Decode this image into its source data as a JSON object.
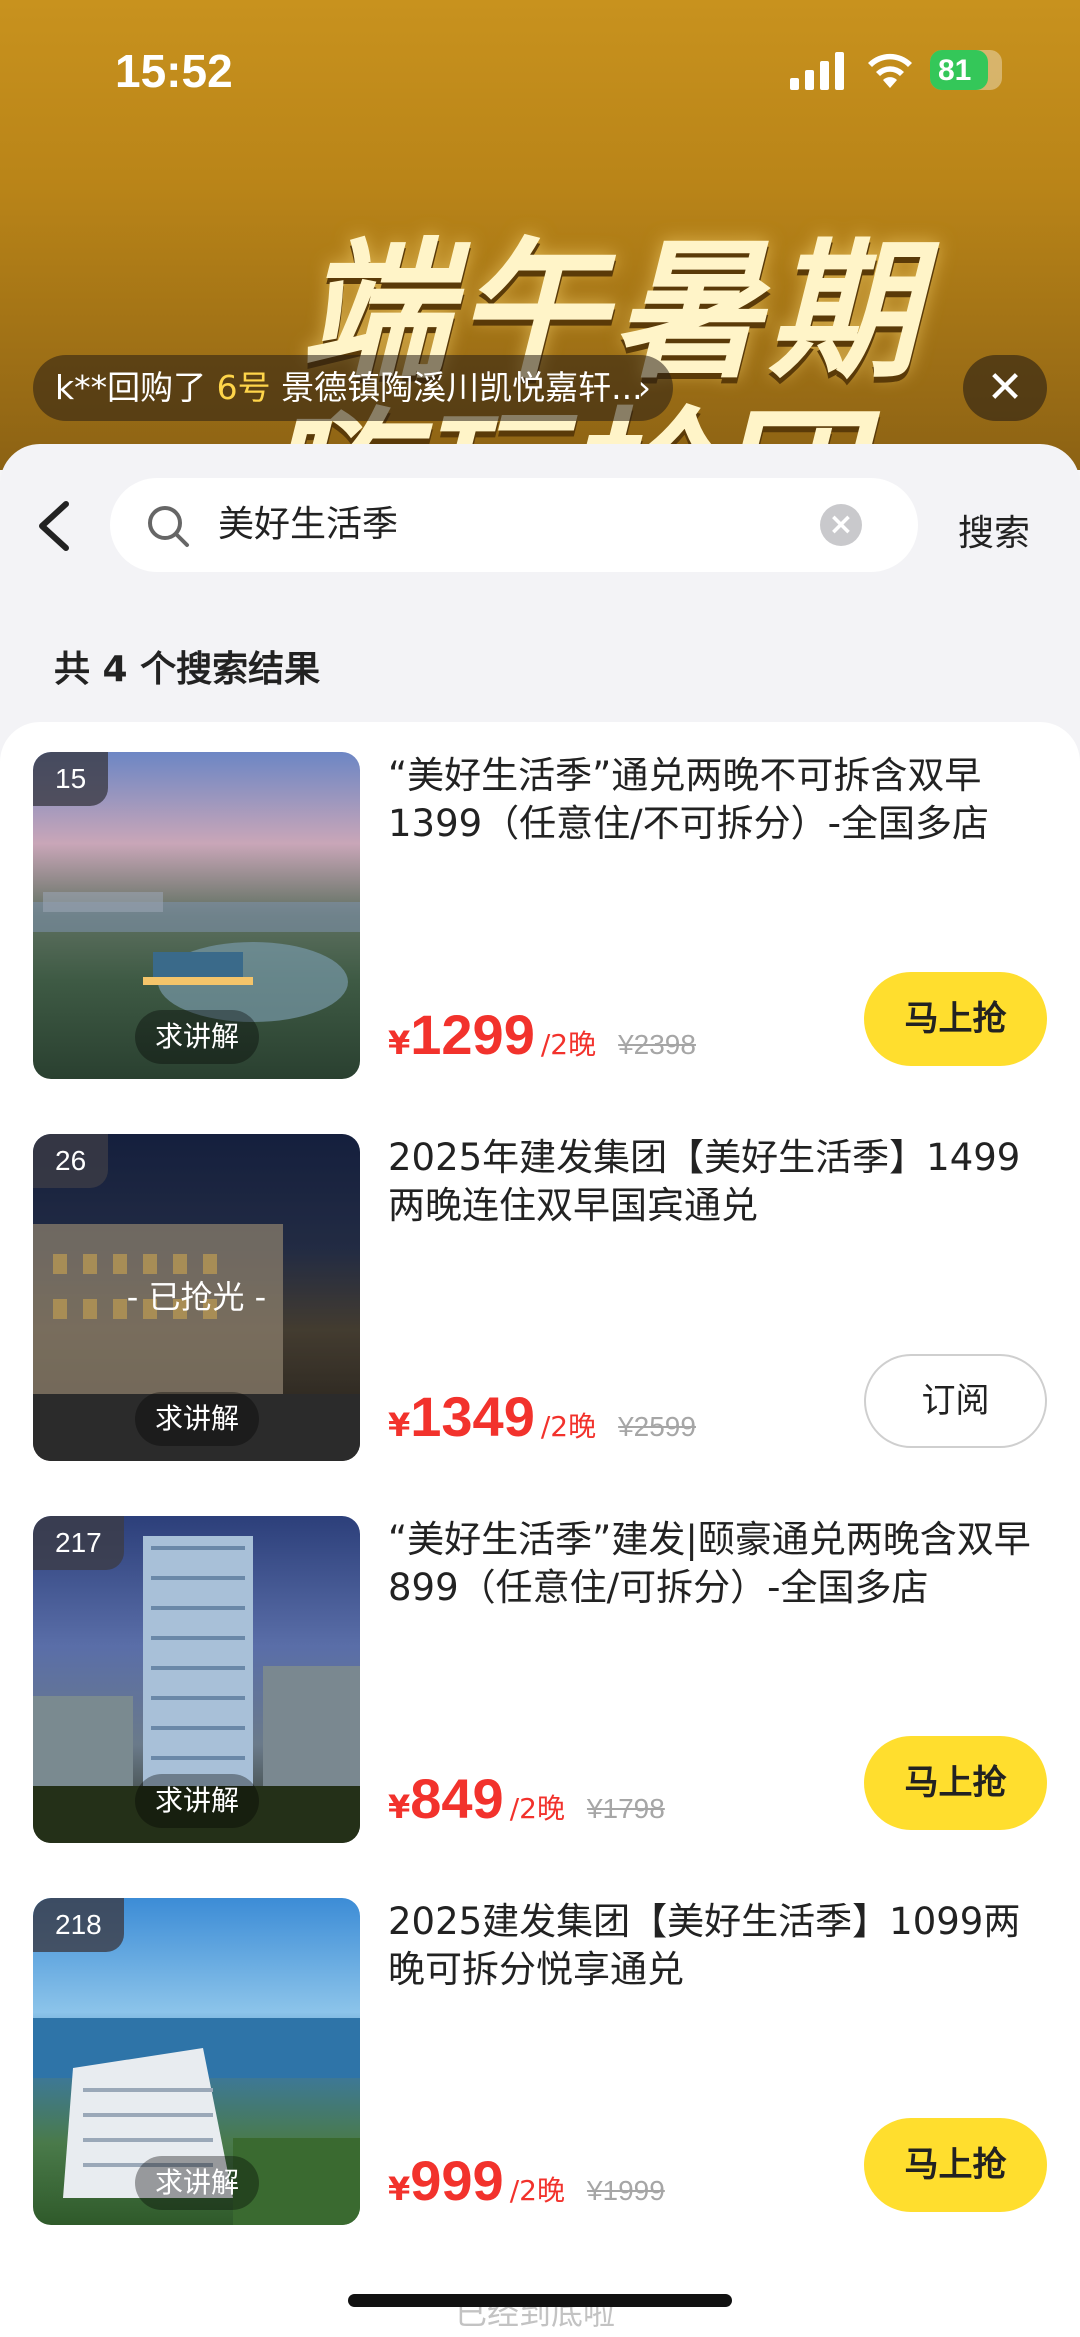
{
  "status_bar": {
    "time": "15:52",
    "battery": "81"
  },
  "banner": {
    "title": "端午暑期",
    "title_line2": "嗨玩抢团",
    "ticker": {
      "prefix": "k**回购了 ",
      "highlight": "6号",
      "suffix": " 景德镇陶溪川凯悦嘉轩...",
      "arrow": "›"
    },
    "close_label": "✕"
  },
  "search": {
    "query": "美好生活季",
    "button_label": "搜索"
  },
  "results": {
    "count_label": "共 4 个搜索结果"
  },
  "products": [
    {
      "badge": "15",
      "explain_label": "求讲解",
      "sold_out_label": "",
      "title": "“美好生活季”通兑两晚不可拆含双早1399（任意住/不可拆分）-全国多店",
      "currency": "¥",
      "price": "1299",
      "unit": "/2晚",
      "original_price": "¥2398",
      "button_label": "马上抢",
      "button_type": "buy"
    },
    {
      "badge": "26",
      "explain_label": "求讲解",
      "sold_out_label": "- 已抢光 -",
      "title": "2025年建发集团【美好生活季】1499两晚连住双早国宾通兑",
      "currency": "¥",
      "price": "1349",
      "unit": "/2晚",
      "original_price": "¥2599",
      "button_label": "订阅",
      "button_type": "subscribe"
    },
    {
      "badge": "217",
      "explain_label": "求讲解",
      "sold_out_label": "",
      "title": "“美好生活季”建发|颐豪通兑两晚含双早899（任意住/可拆分）-全国多店",
      "currency": "¥",
      "price": "849",
      "unit": "/2晚",
      "original_price": "¥1798",
      "button_label": "马上抢",
      "button_type": "buy"
    },
    {
      "badge": "218",
      "explain_label": "求讲解",
      "sold_out_label": "",
      "title": "2025建发集团【美好生活季】1099两晚可拆分悦享通兑",
      "currency": "¥",
      "price": "999",
      "unit": "/2晚",
      "original_price": "¥1999",
      "button_label": "马上抢",
      "button_type": "buy"
    }
  ],
  "footer": {
    "end_label": "已经到底啦"
  },
  "colors": {
    "accent_price": "#f2322c",
    "buy_button": "#ffde2e",
    "banner_gold": "#c8921e"
  }
}
